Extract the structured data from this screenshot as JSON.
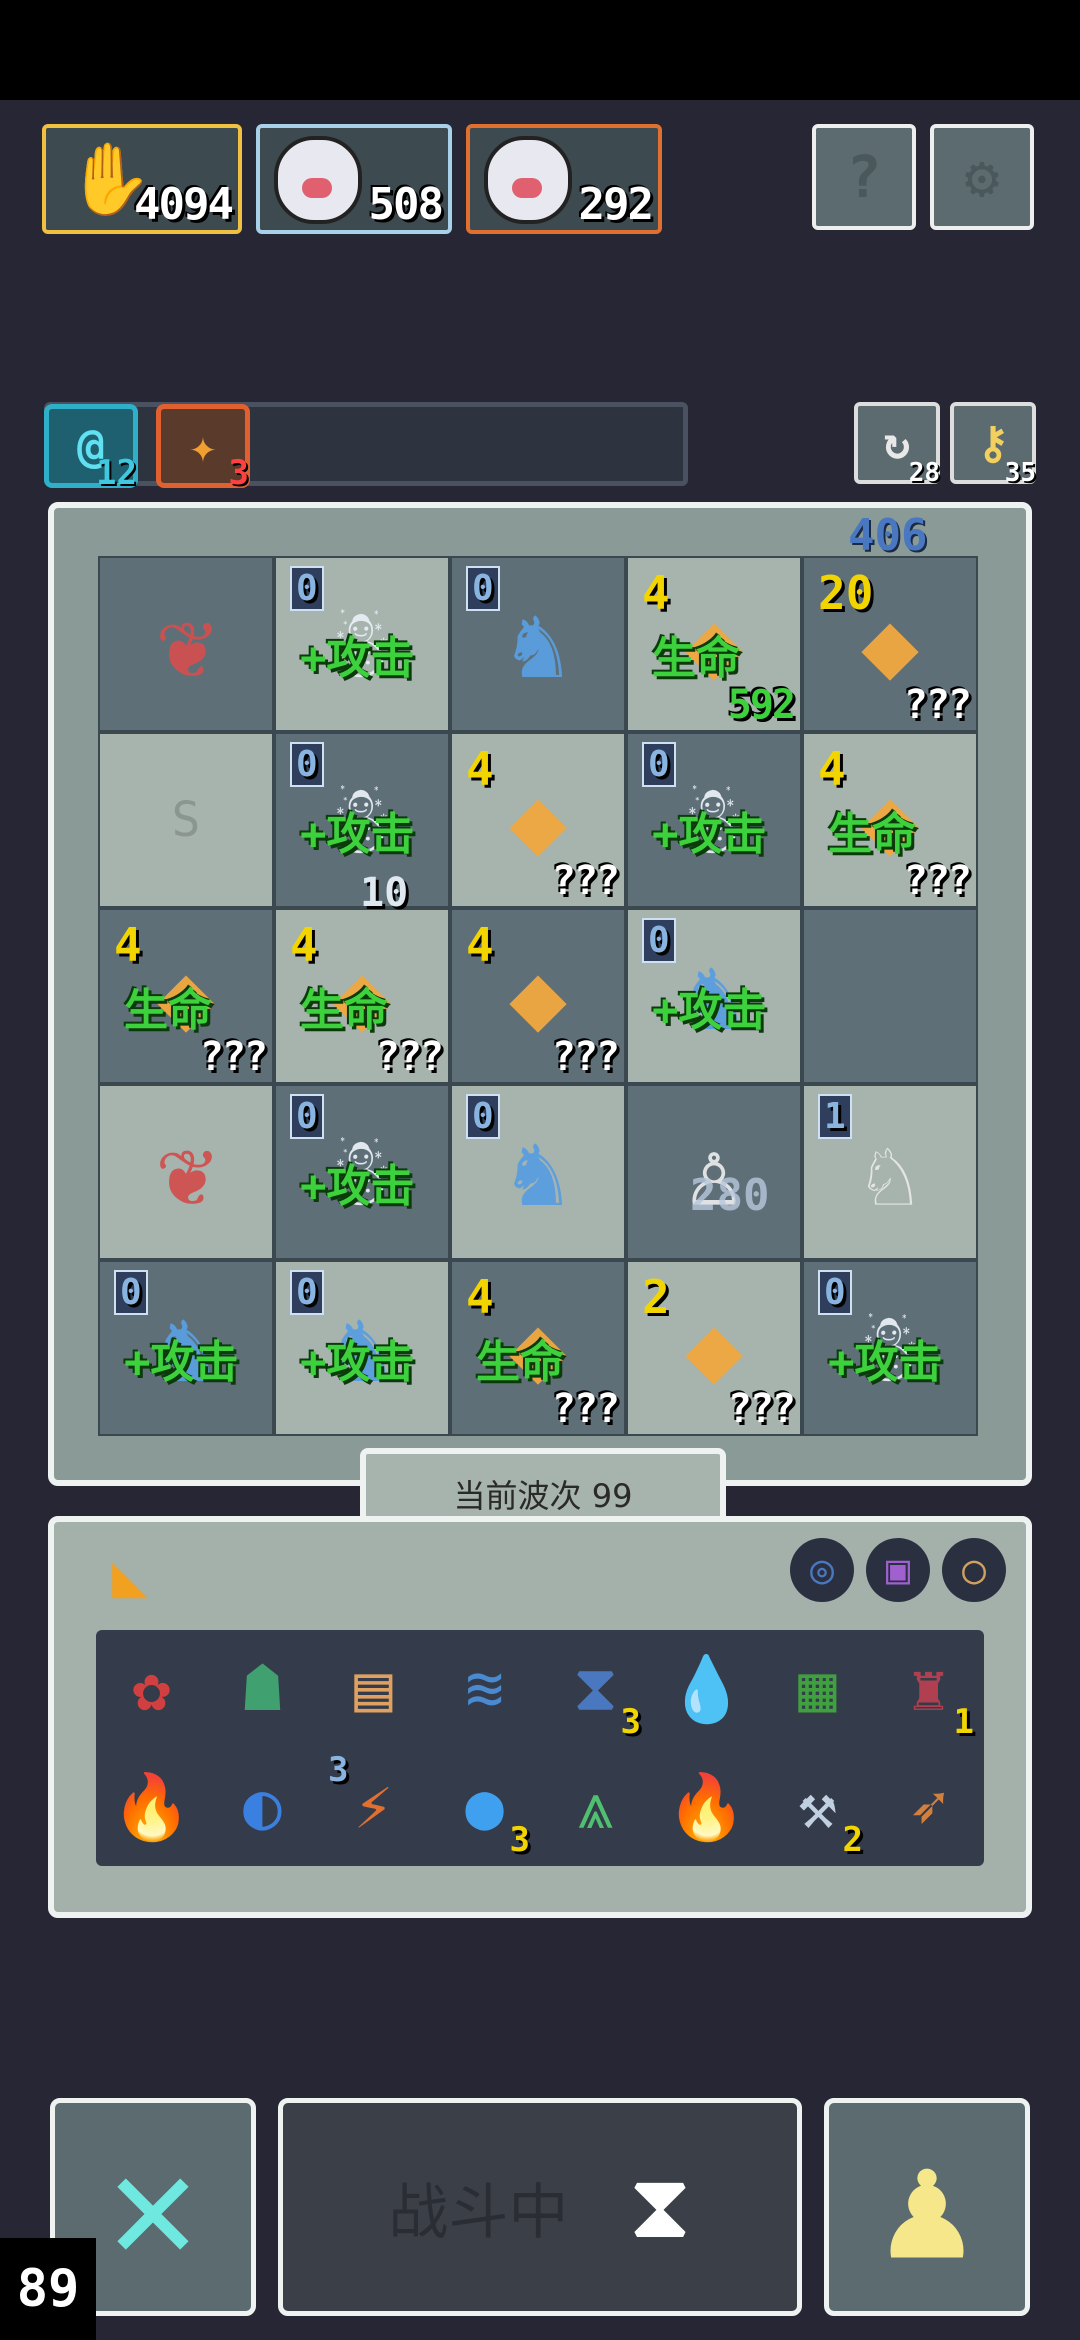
{
  "party": [
    {
      "value": "4094",
      "color": "#f0c040"
    },
    {
      "value": "508",
      "color": "#a8d0e8"
    },
    {
      "value": "292",
      "color": "#e07030"
    }
  ],
  "header_buttons": {
    "help_icon": "?",
    "settings_icon": "⚙"
  },
  "status": {
    "shield_count": "12",
    "fire_count": "3",
    "refresh_count": "28",
    "key_count": "35"
  },
  "board": {
    "cells": [
      {
        "level": "",
        "tag": "",
        "extra": "",
        "icon": "plant-icon",
        "glyph": "❦"
      },
      {
        "level": "0",
        "tag": "+攻击",
        "extra": "",
        "icon": "ghost-icon",
        "glyph": "☃"
      },
      {
        "level": "0",
        "tag": "",
        "extra": "",
        "icon": "demon-icon",
        "glyph": "♞"
      },
      {
        "level": "4",
        "tag": "生命",
        "extra": "592",
        "icon": "heal-icon",
        "glyph": "◆"
      },
      {
        "level": "20",
        "tag": "",
        "extra": "???",
        "icon": "crystal-icon",
        "glyph": "◆"
      },
      {
        "level": "",
        "tag": "",
        "extra": "",
        "icon": "empty-slot",
        "glyph": "S"
      },
      {
        "level": "0",
        "tag": "+攻击",
        "extra": "",
        "icon": "ghost-icon",
        "glyph": "☃"
      },
      {
        "level": "4",
        "tag": "",
        "extra": "???",
        "icon": "crystal-icon",
        "glyph": "◆"
      },
      {
        "level": "0",
        "tag": "+攻击",
        "extra": "",
        "icon": "ghost-icon",
        "glyph": "☃"
      },
      {
        "level": "4",
        "tag": "生命",
        "extra": "???",
        "icon": "heal-icon",
        "glyph": "◆"
      },
      {
        "level": "4",
        "tag": "生命",
        "extra": "???",
        "icon": "heal-icon",
        "glyph": "◆"
      },
      {
        "level": "4",
        "tag": "生命",
        "extra": "???",
        "icon": "heal-icon",
        "glyph": "◆"
      },
      {
        "level": "4",
        "tag": "",
        "extra": "???",
        "icon": "crystal-icon",
        "glyph": "◆"
      },
      {
        "level": "0",
        "tag": "+攻击",
        "extra": "",
        "icon": "demon-icon",
        "glyph": "♞"
      },
      {
        "level": "",
        "tag": "",
        "extra": "",
        "icon": "empty-slot",
        "glyph": ""
      },
      {
        "level": "",
        "tag": "",
        "extra": "",
        "icon": "plant-icon",
        "glyph": "❦"
      },
      {
        "level": "0",
        "tag": "+攻击",
        "extra": "",
        "icon": "ghost-icon",
        "glyph": "☃"
      },
      {
        "level": "0",
        "tag": "",
        "extra": "",
        "icon": "demon-icon",
        "glyph": "♞"
      },
      {
        "level": "",
        "tag": "",
        "extra": "",
        "icon": "hero-icon",
        "glyph": "♙"
      },
      {
        "level": "1",
        "tag": "",
        "extra": "",
        "icon": "knight-icon",
        "glyph": "♘"
      },
      {
        "level": "0",
        "tag": "+攻击",
        "extra": "",
        "icon": "demon-icon",
        "glyph": "♞"
      },
      {
        "level": "0",
        "tag": "+攻击",
        "extra": "",
        "icon": "demon-icon",
        "glyph": "♞"
      },
      {
        "level": "4",
        "tag": "生命",
        "extra": "???",
        "icon": "heal-icon",
        "glyph": "◆"
      },
      {
        "level": "2",
        "tag": "",
        "extra": "???",
        "icon": "crystal-icon",
        "glyph": "◆"
      },
      {
        "level": "0",
        "tag": "+攻击",
        "extra": "",
        "icon": "ghost-icon",
        "glyph": "☃"
      }
    ],
    "floating": {
      "top_right": "406",
      "damage": "10",
      "mid": "280"
    }
  },
  "wave_label": "当前波次 99",
  "inventory": {
    "tab_icon": "◣",
    "equipped": [
      {
        "icon": "ring-icon",
        "glyph": "◎",
        "color": "#4a78c0"
      },
      {
        "icon": "amulet-icon",
        "glyph": "▣",
        "color": "#a060d0"
      },
      {
        "icon": "bracelet-icon",
        "glyph": "○",
        "color": "#d0a060"
      }
    ],
    "items": [
      {
        "icon": "crab-icon",
        "glyph": "✿",
        "count": ""
      },
      {
        "icon": "helmet-icon",
        "glyph": "☗",
        "count": ""
      },
      {
        "icon": "scroll-icon",
        "glyph": "▤",
        "count": ""
      },
      {
        "icon": "wind-icon",
        "glyph": "≋",
        "count": ""
      },
      {
        "icon": "hourglass-icon",
        "glyph": "⧗",
        "count": "3"
      },
      {
        "icon": "droplet-icon",
        "glyph": "💧",
        "count": ""
      },
      {
        "icon": "map-icon",
        "glyph": "▦",
        "count": ""
      },
      {
        "icon": "anvil-icon",
        "glyph": "♜",
        "count": "1"
      },
      {
        "icon": "fire-tile-icon",
        "glyph": "🔥",
        "count": ""
      },
      {
        "icon": "fish-icon",
        "glyph": "◐",
        "count": ""
      },
      {
        "icon": "thunder-book-icon",
        "glyph": "⚡",
        "count": "3",
        "count_pos": "left"
      },
      {
        "icon": "orb-icon",
        "glyph": "●",
        "count": "3"
      },
      {
        "icon": "grass-icon",
        "glyph": "⩓",
        "count": ""
      },
      {
        "icon": "fire-tile-icon",
        "glyph": "🔥",
        "count": ""
      },
      {
        "icon": "axe-icon",
        "glyph": "⚒",
        "count": "2"
      },
      {
        "icon": "spear-icon",
        "glyph": "➶",
        "count": ""
      }
    ]
  },
  "controls": {
    "battle_label": "战斗中",
    "level": "89"
  }
}
